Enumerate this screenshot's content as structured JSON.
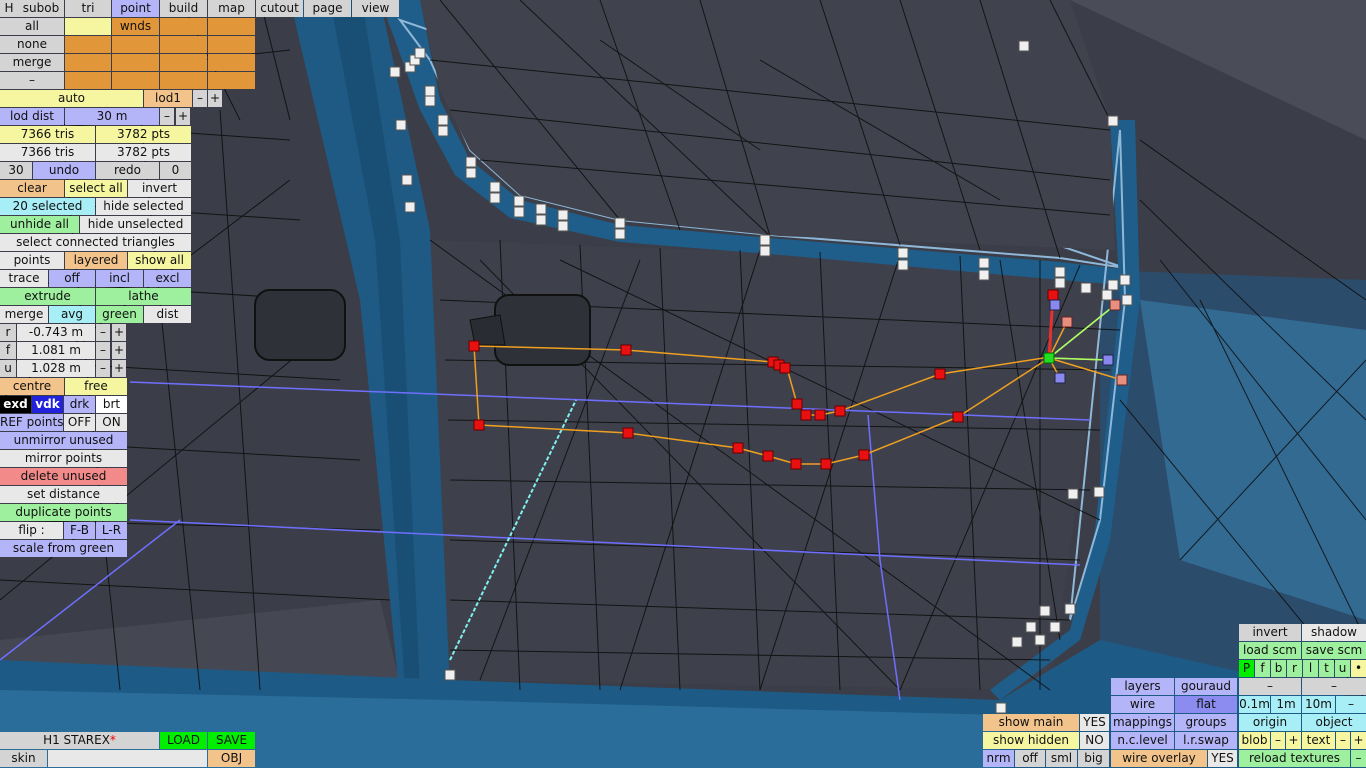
{
  "menu": {
    "h": "H",
    "items": [
      "subob",
      "tri",
      "point",
      "build",
      "map",
      "cutout",
      "page",
      "view"
    ],
    "active": "point"
  },
  "selection_panel": {
    "all": "all",
    "none": "none",
    "merge": "merge",
    "dash": "–",
    "wnds": "wnds"
  },
  "lod": {
    "auto": "auto",
    "lod_name": "lod1",
    "minus": "–",
    "plus": "+",
    "dist_label": "lod dist",
    "dist_value": "30 m"
  },
  "stats": {
    "tris_1": "7366 tris",
    "pts_1": "3782 pts",
    "tris_2": "7366 tris",
    "pts_2": "3782 pts"
  },
  "history": {
    "count": "30",
    "undo": "undo",
    "redo": "redo",
    "redo_count": "0"
  },
  "tools": {
    "clear": "clear",
    "select_all": "select all",
    "invert": "invert",
    "selected": "20 selected",
    "hide_selected": "hide selected",
    "unhide_all": "unhide all",
    "hide_unselected": "hide unselected",
    "select_connected": "select connected triangles",
    "points": "points",
    "layered": "layered",
    "show_all": "show all",
    "trace": "trace",
    "off": "off",
    "incl": "incl",
    "excl": "excl",
    "extrude": "extrude",
    "lathe": "lathe",
    "merge": "merge",
    "avg": "avg",
    "green": "green",
    "dist": "dist"
  },
  "coords": [
    {
      "axis": "r",
      "value": "-0.743 m"
    },
    {
      "axis": "f",
      "value": "1.081 m"
    },
    {
      "axis": "u",
      "value": "1.028 m"
    }
  ],
  "transform": {
    "centre": "centre",
    "free": "free",
    "exd": "exd",
    "vdk": "vdk",
    "drk": "drk",
    "brt": "brt",
    "ref_points": "REF points",
    "ref_off": "OFF",
    "ref_on": "ON",
    "unmirror_unused": "unmirror unused",
    "mirror_points": "mirror points",
    "delete_unused": "delete unused",
    "set_distance": "set distance",
    "duplicate_points": "duplicate points",
    "flip": "flip :",
    "fb": "F-B",
    "lr": "L-R",
    "scale_from_green": "scale from green"
  },
  "file": {
    "name": "H1 STAREX",
    "modified": "*",
    "load": "LOAD",
    "save": "SAVE",
    "skin": "skin",
    "obj": "OBJ"
  },
  "display": {
    "show_main": "show main",
    "show_main_val": "YES",
    "show_hidden": "show hidden",
    "show_hidden_val": "NO",
    "nrm": "nrm",
    "off": "off",
    "sml": "sml",
    "big": "big",
    "layers": "layers",
    "gouraud": "gouraud",
    "wire": "wire",
    "flat": "flat",
    "mappings": "mappings",
    "groups": "groups",
    "nc_level": "n.c.level",
    "lr_swap": "l.r.swap",
    "wire_overlay": "wire overlay",
    "wire_overlay_val": "YES"
  },
  "right_panel": {
    "invert": "invert",
    "shadow": "shadow",
    "load_scm": "load scm",
    "save_scm": "save scm",
    "flags": [
      "P",
      "f",
      "b",
      "r",
      "l",
      "t",
      "u",
      "•"
    ],
    "dash": "–",
    "grid": [
      "0.1m",
      "1m",
      "10m",
      "–"
    ],
    "origin": "origin",
    "object": "object",
    "blob": "blob",
    "minus": "–",
    "plus": "+",
    "text": "text",
    "reload_textures": "reload textures"
  },
  "colors": {
    "selected_point": "#ee1111",
    "green_point": "#22dd22",
    "outline": "#f0a020",
    "mesh_bg": "#3a3d46",
    "trim": "#1d5c86"
  }
}
